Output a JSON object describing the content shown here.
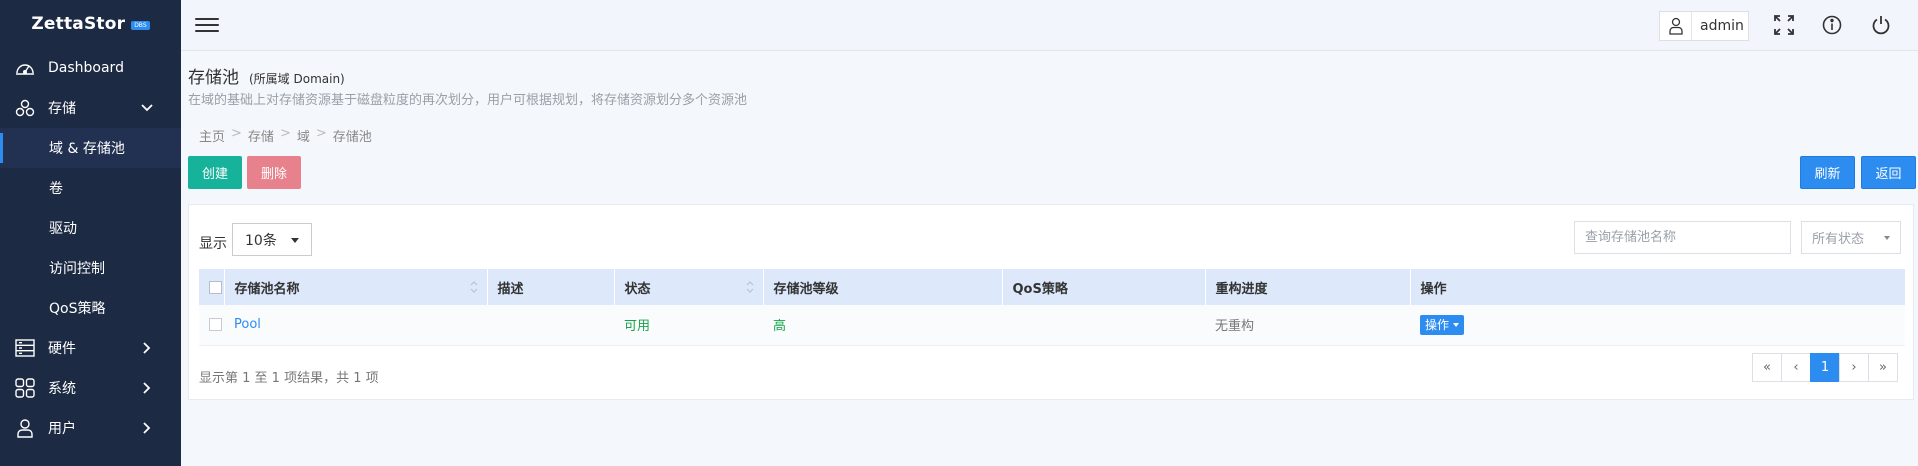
{
  "brand": {
    "name": "ZettaStor",
    "badge": "DBS"
  },
  "sidebar": {
    "items": [
      {
        "label": "Dashboard",
        "icon": "gauge-icon"
      },
      {
        "label": "存储",
        "icon": "storage-icon",
        "expanded": true,
        "children": [
          {
            "label": "域 & 存储池",
            "active": true
          },
          {
            "label": "卷"
          },
          {
            "label": "驱动"
          },
          {
            "label": "访问控制"
          },
          {
            "label": "QoS策略"
          }
        ]
      },
      {
        "label": "硬件",
        "icon": "server-icon"
      },
      {
        "label": "系统",
        "icon": "grid-icon"
      },
      {
        "label": "用户",
        "icon": "user-icon"
      }
    ]
  },
  "header": {
    "username": "admin"
  },
  "page": {
    "title": "存储池",
    "scope": "(所属域 Domain)",
    "description": "在域的基础上对存储资源基于磁盘粒度的再次划分，用户可根据规划，将存储资源划分多个资源池"
  },
  "breadcrumb": [
    "主页",
    "存储",
    "域",
    "存储池"
  ],
  "breadcrumb_sep": ">",
  "toolbar": {
    "create": "创建",
    "delete": "删除",
    "refresh": "刷新",
    "back": "返回"
  },
  "table_controls": {
    "show_label": "显示",
    "page_size": "10条",
    "search_placeholder": "查询存储池名称",
    "status_filter": "所有状态"
  },
  "table": {
    "columns": [
      "存储池名称",
      "描述",
      "状态",
      "存储池等级",
      "QoS策略",
      "重构进度",
      "操作"
    ],
    "rows": [
      {
        "name": "Pool",
        "description": "",
        "status": "可用",
        "level": "高",
        "qos": "",
        "rebuild": "无重构",
        "action": "操作"
      }
    ]
  },
  "footer": {
    "summary": "显示第 1 至 1 项结果，共 1 项"
  },
  "pagination": {
    "first": "«",
    "prev": "‹",
    "current": "1",
    "next": "›",
    "last": "»"
  },
  "colors": {
    "sidebar_bg": "#1d2a43",
    "accent": "#2d8cf0",
    "create": "#16b39a",
    "delete": "#e7828d",
    "status_ok": "#16a34a"
  }
}
